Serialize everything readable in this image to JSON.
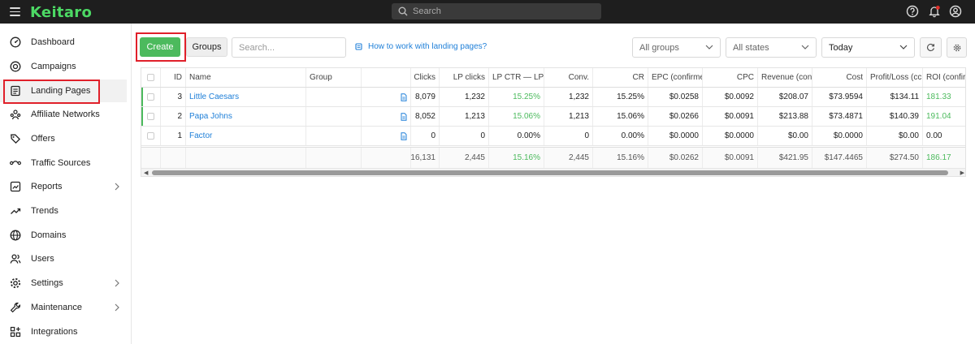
{
  "app": {
    "logo": "Keitaro",
    "search_placeholder": "Search"
  },
  "sidebar": {
    "items": [
      {
        "label": "Dashboard"
      },
      {
        "label": "Campaigns"
      },
      {
        "label": "Landing Pages"
      },
      {
        "label": "Affiliate Networks"
      },
      {
        "label": "Offers"
      },
      {
        "label": "Traffic Sources"
      },
      {
        "label": "Reports"
      },
      {
        "label": "Trends"
      },
      {
        "label": "Domains"
      },
      {
        "label": "Users"
      },
      {
        "label": "Settings"
      },
      {
        "label": "Maintenance"
      },
      {
        "label": "Integrations"
      }
    ]
  },
  "toolbar": {
    "create_label": "Create",
    "groups_label": "Groups",
    "search_placeholder": "Search...",
    "howto_label": "How to work with landing pages?",
    "groups_select": "All groups",
    "states_select": "All states",
    "period_select": "Today"
  },
  "table": {
    "headers": [
      "ID",
      "Name",
      "Group",
      "Clicks",
      "LP clicks",
      "LP CTR — LP C",
      "Conv.",
      "CR",
      "EPC (confirmed",
      "CPC",
      "Revenue (confi",
      "Cost",
      "Profit/Loss (cc",
      "ROI (confirme"
    ],
    "rows": [
      {
        "id": "3",
        "name": "Little Caesars",
        "group": "",
        "clicks": "8,079",
        "lp_clicks": "1,232",
        "lp_ctr": "15.25%",
        "conv": "1,232",
        "cr": "15.25%",
        "epc": "$0.0258",
        "cpc": "$0.0092",
        "revenue": "$208.07",
        "cost": "$73.9594",
        "profit": "$134.11",
        "roi": "181.33"
      },
      {
        "id": "2",
        "name": "Papa Johns",
        "group": "",
        "clicks": "8,052",
        "lp_clicks": "1,213",
        "lp_ctr": "15.06%",
        "conv": "1,213",
        "cr": "15.06%",
        "epc": "$0.0266",
        "cpc": "$0.0091",
        "revenue": "$213.88",
        "cost": "$73.4871",
        "profit": "$140.39",
        "roi": "191.04"
      },
      {
        "id": "1",
        "name": "Factor",
        "group": "",
        "clicks": "0",
        "lp_clicks": "0",
        "lp_ctr": "0.00%",
        "conv": "0",
        "cr": "0.00%",
        "epc": "$0.0000",
        "cpc": "$0.0000",
        "revenue": "$0.00",
        "cost": "$0.0000",
        "profit": "$0.00",
        "roi": "0.00"
      }
    ],
    "totals": {
      "clicks": "16,131",
      "lp_clicks": "2,445",
      "lp_ctr": "15.16%",
      "conv": "2,445",
      "cr": "15.16%",
      "epc": "$0.0262",
      "cpc": "$0.0091",
      "revenue": "$421.95",
      "cost": "$147.4465",
      "profit": "$274.50",
      "roi": "186.17"
    }
  },
  "colors": {
    "accent": "#4cba5d",
    "link": "#1e7fd8",
    "highlight": "#e0202a",
    "topbar": "#1e1e1e"
  }
}
